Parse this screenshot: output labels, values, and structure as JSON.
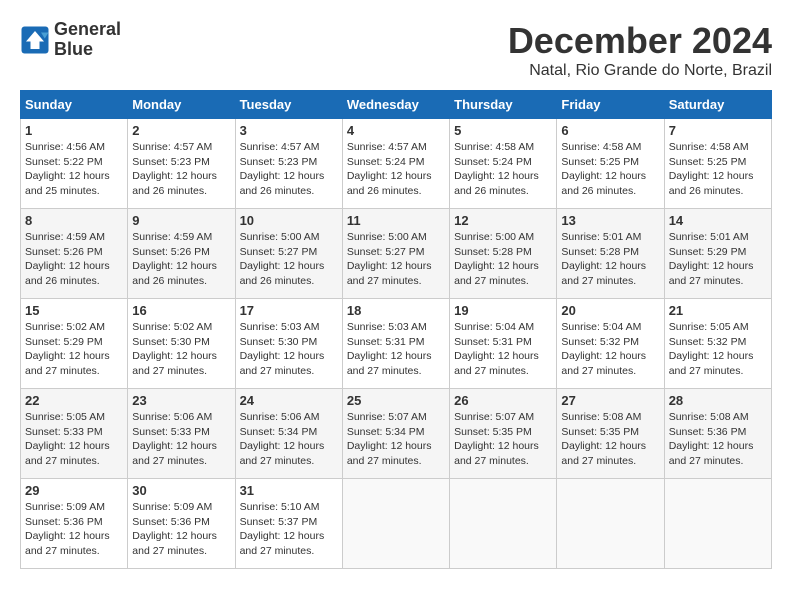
{
  "logo": {
    "line1": "General",
    "line2": "Blue"
  },
  "title": "December 2024",
  "subtitle": "Natal, Rio Grande do Norte, Brazil",
  "days_of_week": [
    "Sunday",
    "Monday",
    "Tuesday",
    "Wednesday",
    "Thursday",
    "Friday",
    "Saturday"
  ],
  "weeks": [
    [
      {
        "day": "1",
        "sunrise": "4:56 AM",
        "sunset": "5:22 PM",
        "daylight": "12 hours and 25 minutes."
      },
      {
        "day": "2",
        "sunrise": "4:57 AM",
        "sunset": "5:23 PM",
        "daylight": "12 hours and 26 minutes."
      },
      {
        "day": "3",
        "sunrise": "4:57 AM",
        "sunset": "5:23 PM",
        "daylight": "12 hours and 26 minutes."
      },
      {
        "day": "4",
        "sunrise": "4:57 AM",
        "sunset": "5:24 PM",
        "daylight": "12 hours and 26 minutes."
      },
      {
        "day": "5",
        "sunrise": "4:58 AM",
        "sunset": "5:24 PM",
        "daylight": "12 hours and 26 minutes."
      },
      {
        "day": "6",
        "sunrise": "4:58 AM",
        "sunset": "5:25 PM",
        "daylight": "12 hours and 26 minutes."
      },
      {
        "day": "7",
        "sunrise": "4:58 AM",
        "sunset": "5:25 PM",
        "daylight": "12 hours and 26 minutes."
      }
    ],
    [
      {
        "day": "8",
        "sunrise": "4:59 AM",
        "sunset": "5:26 PM",
        "daylight": "12 hours and 26 minutes."
      },
      {
        "day": "9",
        "sunrise": "4:59 AM",
        "sunset": "5:26 PM",
        "daylight": "12 hours and 26 minutes."
      },
      {
        "day": "10",
        "sunrise": "5:00 AM",
        "sunset": "5:27 PM",
        "daylight": "12 hours and 26 minutes."
      },
      {
        "day": "11",
        "sunrise": "5:00 AM",
        "sunset": "5:27 PM",
        "daylight": "12 hours and 27 minutes."
      },
      {
        "day": "12",
        "sunrise": "5:00 AM",
        "sunset": "5:28 PM",
        "daylight": "12 hours and 27 minutes."
      },
      {
        "day": "13",
        "sunrise": "5:01 AM",
        "sunset": "5:28 PM",
        "daylight": "12 hours and 27 minutes."
      },
      {
        "day": "14",
        "sunrise": "5:01 AM",
        "sunset": "5:29 PM",
        "daylight": "12 hours and 27 minutes."
      }
    ],
    [
      {
        "day": "15",
        "sunrise": "5:02 AM",
        "sunset": "5:29 PM",
        "daylight": "12 hours and 27 minutes."
      },
      {
        "day": "16",
        "sunrise": "5:02 AM",
        "sunset": "5:30 PM",
        "daylight": "12 hours and 27 minutes."
      },
      {
        "day": "17",
        "sunrise": "5:03 AM",
        "sunset": "5:30 PM",
        "daylight": "12 hours and 27 minutes."
      },
      {
        "day": "18",
        "sunrise": "5:03 AM",
        "sunset": "5:31 PM",
        "daylight": "12 hours and 27 minutes."
      },
      {
        "day": "19",
        "sunrise": "5:04 AM",
        "sunset": "5:31 PM",
        "daylight": "12 hours and 27 minutes."
      },
      {
        "day": "20",
        "sunrise": "5:04 AM",
        "sunset": "5:32 PM",
        "daylight": "12 hours and 27 minutes."
      },
      {
        "day": "21",
        "sunrise": "5:05 AM",
        "sunset": "5:32 PM",
        "daylight": "12 hours and 27 minutes."
      }
    ],
    [
      {
        "day": "22",
        "sunrise": "5:05 AM",
        "sunset": "5:33 PM",
        "daylight": "12 hours and 27 minutes."
      },
      {
        "day": "23",
        "sunrise": "5:06 AM",
        "sunset": "5:33 PM",
        "daylight": "12 hours and 27 minutes."
      },
      {
        "day": "24",
        "sunrise": "5:06 AM",
        "sunset": "5:34 PM",
        "daylight": "12 hours and 27 minutes."
      },
      {
        "day": "25",
        "sunrise": "5:07 AM",
        "sunset": "5:34 PM",
        "daylight": "12 hours and 27 minutes."
      },
      {
        "day": "26",
        "sunrise": "5:07 AM",
        "sunset": "5:35 PM",
        "daylight": "12 hours and 27 minutes."
      },
      {
        "day": "27",
        "sunrise": "5:08 AM",
        "sunset": "5:35 PM",
        "daylight": "12 hours and 27 minutes."
      },
      {
        "day": "28",
        "sunrise": "5:08 AM",
        "sunset": "5:36 PM",
        "daylight": "12 hours and 27 minutes."
      }
    ],
    [
      {
        "day": "29",
        "sunrise": "5:09 AM",
        "sunset": "5:36 PM",
        "daylight": "12 hours and 27 minutes."
      },
      {
        "day": "30",
        "sunrise": "5:09 AM",
        "sunset": "5:36 PM",
        "daylight": "12 hours and 27 minutes."
      },
      {
        "day": "31",
        "sunrise": "5:10 AM",
        "sunset": "5:37 PM",
        "daylight": "12 hours and 27 minutes."
      },
      null,
      null,
      null,
      null
    ]
  ],
  "labels": {
    "sunrise": "Sunrise:",
    "sunset": "Sunset:",
    "daylight": "Daylight:"
  }
}
